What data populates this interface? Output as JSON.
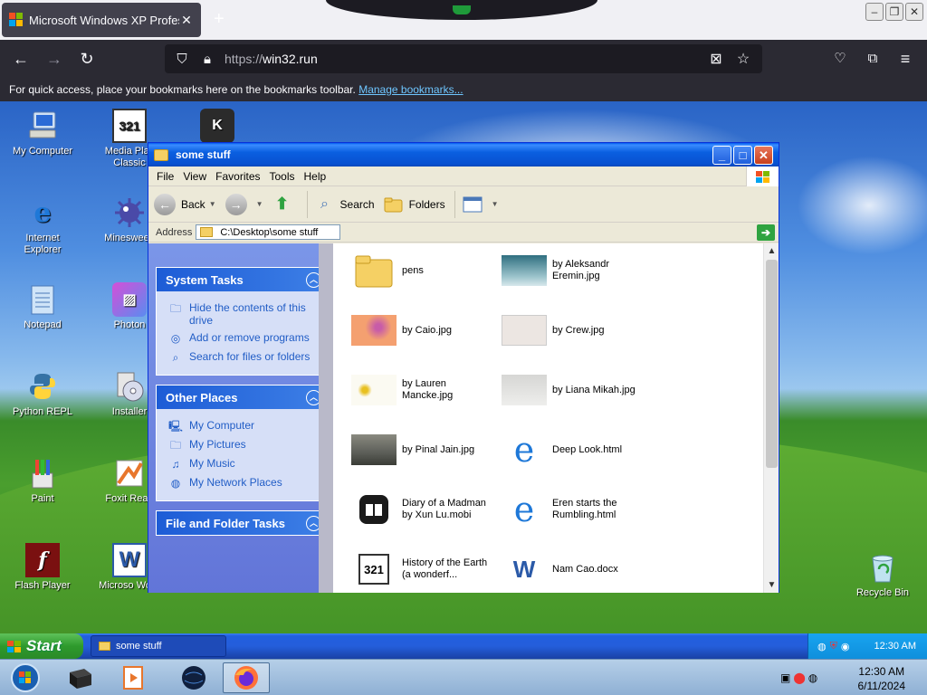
{
  "browser": {
    "tab_title": "Microsoft Windows XP Profess",
    "tab_close": "✕",
    "new_tab": "+",
    "url_scheme": "https://",
    "url_host": "win32.run",
    "bookmarks_text": "For quick access, place your bookmarks here on the bookmarks toolbar.",
    "bookmarks_link": "Manage bookmarks..."
  },
  "desktop_icons": [
    {
      "label": "My Computer"
    },
    {
      "label": "Media Play Classic"
    },
    {
      "label": ""
    },
    {
      "label": "Internet Explorer"
    },
    {
      "label": "Minesweep"
    },
    {
      "label": "Notepad"
    },
    {
      "label": "Photon"
    },
    {
      "label": "Python REPL"
    },
    {
      "label": "Installer"
    },
    {
      "label": "Paint"
    },
    {
      "label": "Foxit Read"
    },
    {
      "label": "Flash Player"
    },
    {
      "label": "Microso Word"
    },
    {
      "label": "Recycle Bin"
    }
  ],
  "window": {
    "title": "some stuff",
    "menu": [
      "File",
      "View",
      "Favorites",
      "Tools",
      "Help"
    ],
    "toolbar": {
      "back": "Back",
      "search": "Search",
      "folders": "Folders"
    },
    "address_label": "Address",
    "address_value": "C:\\Desktop\\some stuff",
    "panels": [
      {
        "title": "System Tasks",
        "items": [
          "Hide the contents of this drive",
          "Add or remove programs",
          "Search for files or folders"
        ]
      },
      {
        "title": "Other Places",
        "items": [
          "My Computer",
          "My Pictures",
          "My Music",
          "My Network Places"
        ]
      },
      {
        "title": "File and Folder Tasks",
        "items": []
      }
    ],
    "files": [
      {
        "name": "pens",
        "kind": "folder"
      },
      {
        "name": "by Aleksandr Eremin.jpg",
        "kind": "image",
        "color": "#4f8a98"
      },
      {
        "name": "by Caio.jpg",
        "kind": "image",
        "color": "#f0a070"
      },
      {
        "name": "by Crew.jpg",
        "kind": "image",
        "color": "#e9e2de"
      },
      {
        "name": "by Lauren Mancke.jpg",
        "kind": "image",
        "color": "#fbfaf2"
      },
      {
        "name": "by Liana Mikah.jpg",
        "kind": "image",
        "color": "#e2e2e0"
      },
      {
        "name": "by Pinal Jain.jpg",
        "kind": "image",
        "color": "#6b6b64"
      },
      {
        "name": "Deep Look.html",
        "kind": "html"
      },
      {
        "name": "Diary of a Madman by Xun Lu.mobi",
        "kind": "mobi"
      },
      {
        "name": "Eren starts the Rumbling.html",
        "kind": "html"
      },
      {
        "name": "History of the Earth (a wonderf...",
        "kind": "video"
      },
      {
        "name": "Nam Cao.docx",
        "kind": "docx"
      }
    ]
  },
  "taskbar": {
    "start": "Start",
    "item": "some stuff",
    "clock": "12:30 AM"
  },
  "host": {
    "time": "12:30 AM",
    "date": "6/11/2024"
  },
  "colors": {
    "xp_blue": "#245edb",
    "start_green": "#2e9a2c",
    "link_blue": "#215dc6"
  }
}
